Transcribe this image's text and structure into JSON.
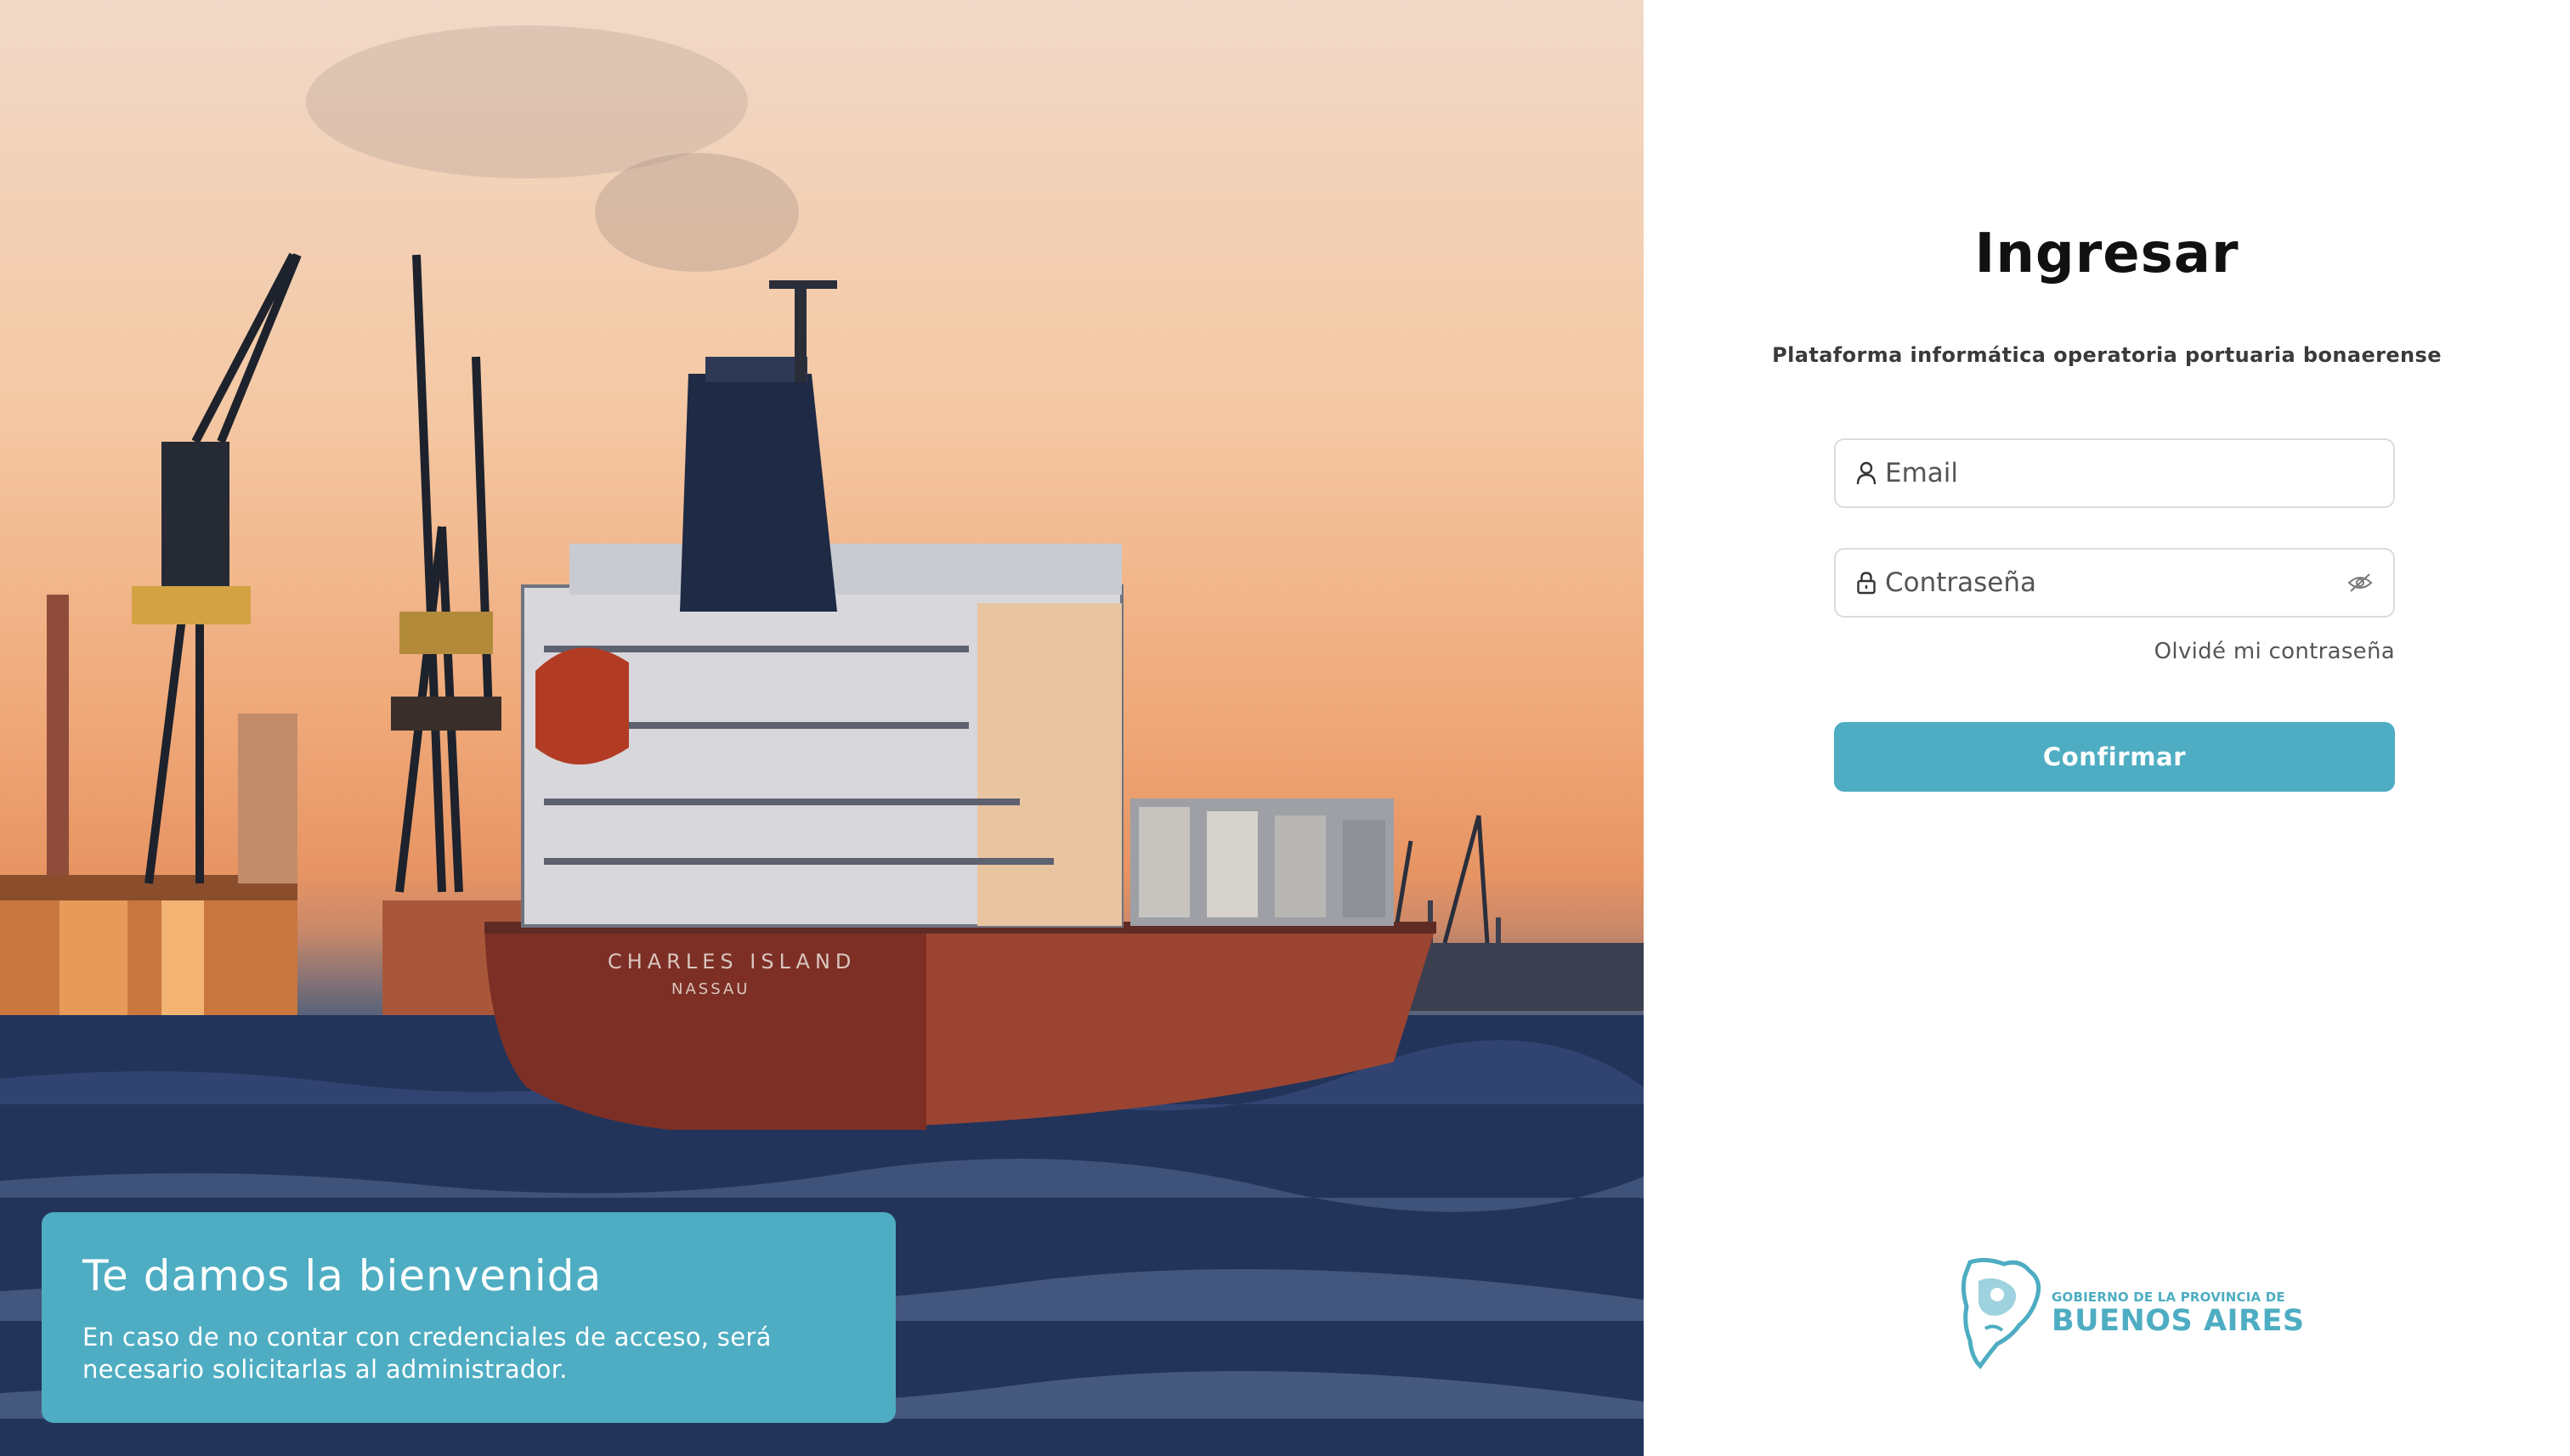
{
  "hero": {
    "welcome_title": "Te damos la bienvenida",
    "welcome_text": "En caso de no contar con credenciales de acceso, será necesario solicitarlas al administrador.",
    "ship_name": "CHARLES ISLAND",
    "ship_port": "NASSAU"
  },
  "login": {
    "title": "Ingresar",
    "subtitle": "Plataforma informática operatoria portuaria bonaerense",
    "email_placeholder": "Email",
    "password_placeholder": "Contraseña",
    "forgot_link": "Olvidé mi contraseña",
    "confirm_button": "Confirmar"
  },
  "logo": {
    "line1": "GOBIERNO DE LA PROVINCIA DE",
    "line2": "BUENOS AIRES"
  },
  "icons": {
    "email": "user-icon",
    "password": "lock-icon",
    "toggle": "eye-slash-icon"
  },
  "colors": {
    "accent": "#4eadc2",
    "title": "#111111",
    "muted": "#555555"
  }
}
